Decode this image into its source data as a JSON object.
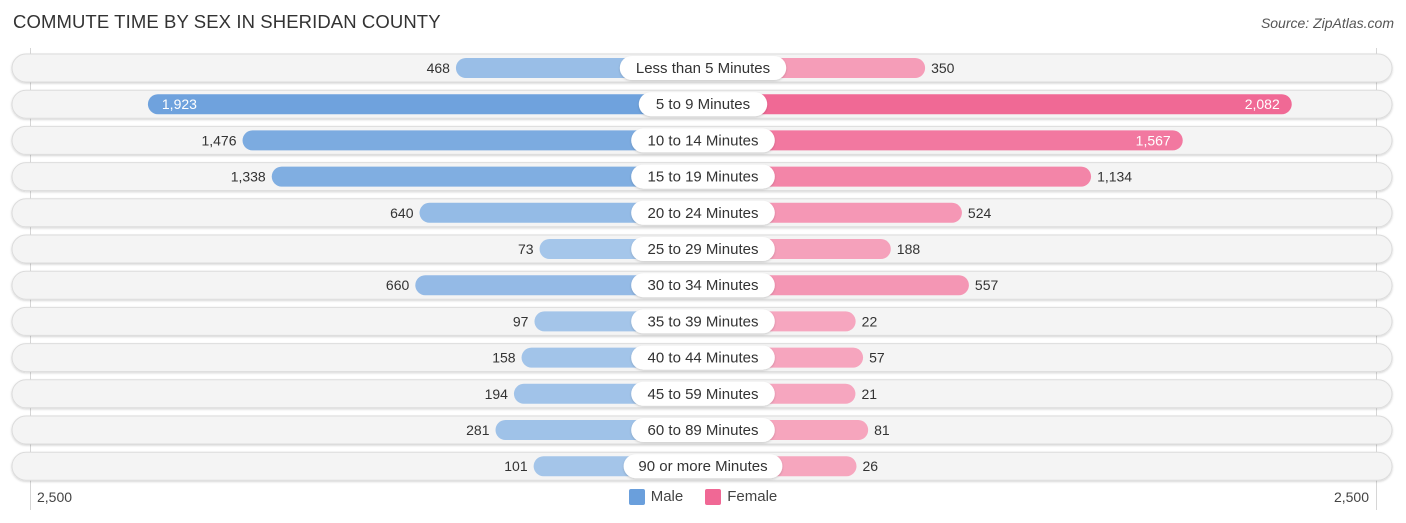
{
  "title": "COMMUTE TIME BY SEX IN SHERIDAN COUNTY",
  "source": "Source: ZipAtlas.com",
  "colors": {
    "male": "#6a9fdc",
    "male_light": "#a7c7ea",
    "female": "#f06895",
    "female_light": "#f6a7bf",
    "row_bg": "#f4f4f4"
  },
  "legend": [
    {
      "label": "Male",
      "key": "male"
    },
    {
      "label": "Female",
      "key": "female"
    }
  ],
  "chart_data": {
    "type": "bar",
    "orientation": "horizontal-diverging",
    "title": "COMMUTE TIME BY SEX IN SHERIDAN COUNTY",
    "categories": [
      "Less than 5 Minutes",
      "5 to 9 Minutes",
      "10 to 14 Minutes",
      "15 to 19 Minutes",
      "20 to 24 Minutes",
      "25 to 29 Minutes",
      "30 to 34 Minutes",
      "35 to 39 Minutes",
      "40 to 44 Minutes",
      "45 to 59 Minutes",
      "60 to 89 Minutes",
      "90 or more Minutes"
    ],
    "series": [
      {
        "name": "Male",
        "values": [
          468,
          1923,
          1476,
          1338,
          640,
          73,
          660,
          97,
          158,
          194,
          281,
          101
        ]
      },
      {
        "name": "Female",
        "values": [
          350,
          2082,
          1567,
          1134,
          524,
          188,
          557,
          22,
          57,
          21,
          81,
          26
        ]
      }
    ],
    "value_labels": {
      "male": [
        "468",
        "1,923",
        "1,476",
        "1,338",
        "640",
        "73",
        "660",
        "97",
        "158",
        "194",
        "281",
        "101"
      ],
      "female": [
        "350",
        "2,082",
        "1,567",
        "1,134",
        "524",
        "188",
        "557",
        "22",
        "57",
        "21",
        "81",
        "26"
      ]
    },
    "axis": {
      "left_label": "2,500",
      "right_label": "2,500",
      "range": [
        0,
        2500
      ]
    },
    "legend_position": "bottom-center",
    "grid": false
  }
}
